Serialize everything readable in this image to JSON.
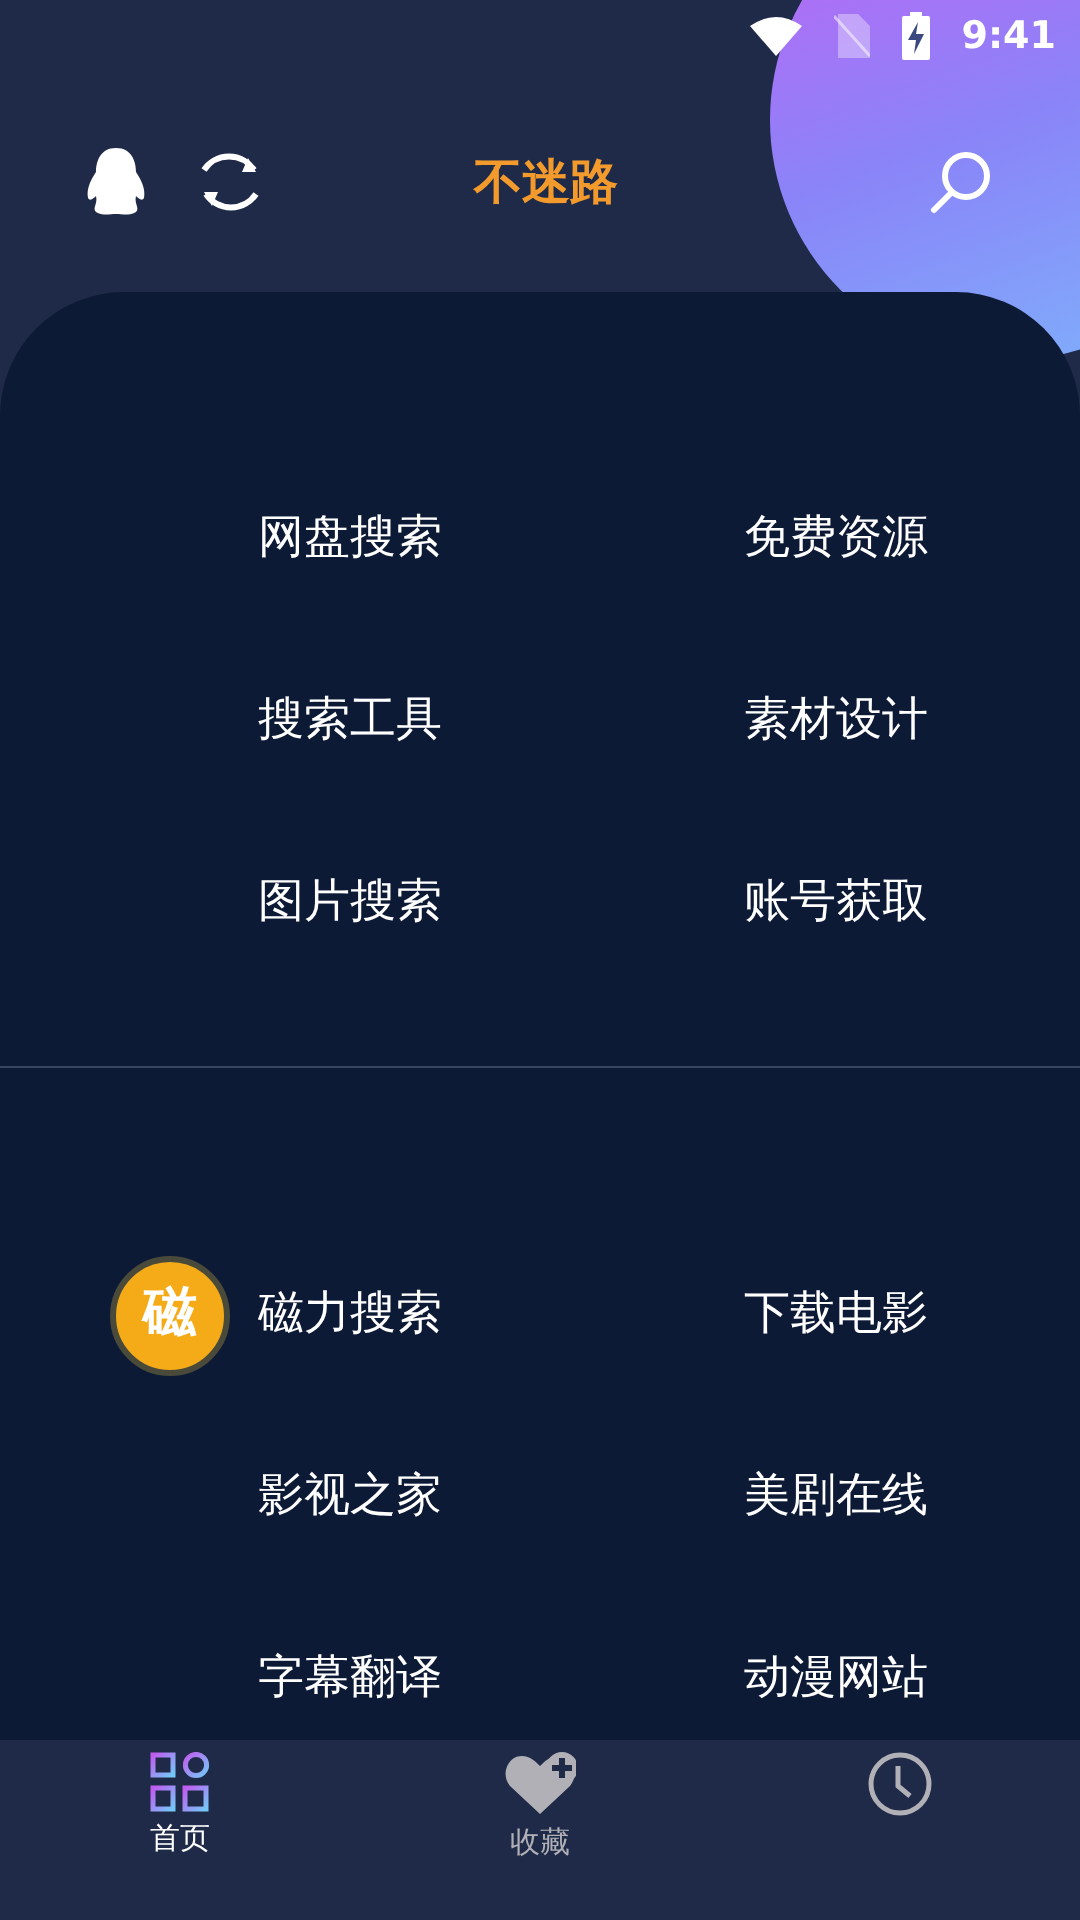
{
  "status_bar": {
    "time": "9:41",
    "sim_missing": true,
    "charging": true
  },
  "header": {
    "title": "不迷路"
  },
  "sections": [
    {
      "items": [
        {
          "label": "网盘搜索"
        },
        {
          "label": "免费资源"
        },
        {
          "label": "搜索工具"
        },
        {
          "label": "素材设计"
        },
        {
          "label": "图片搜索"
        },
        {
          "label": "账号获取"
        }
      ]
    },
    {
      "items": [
        {
          "label": "磁力搜索",
          "badge": "磁"
        },
        {
          "label": "下载电影"
        },
        {
          "label": "影视之家"
        },
        {
          "label": "美剧在线"
        },
        {
          "label": "字幕翻译"
        },
        {
          "label": "动漫网站"
        }
      ]
    }
  ],
  "bottom_nav": [
    {
      "kind": "home",
      "label": "首页",
      "selected": true
    },
    {
      "kind": "favorite",
      "label": "收藏",
      "selected": false
    },
    {
      "kind": "history",
      "selected": false
    }
  ]
}
